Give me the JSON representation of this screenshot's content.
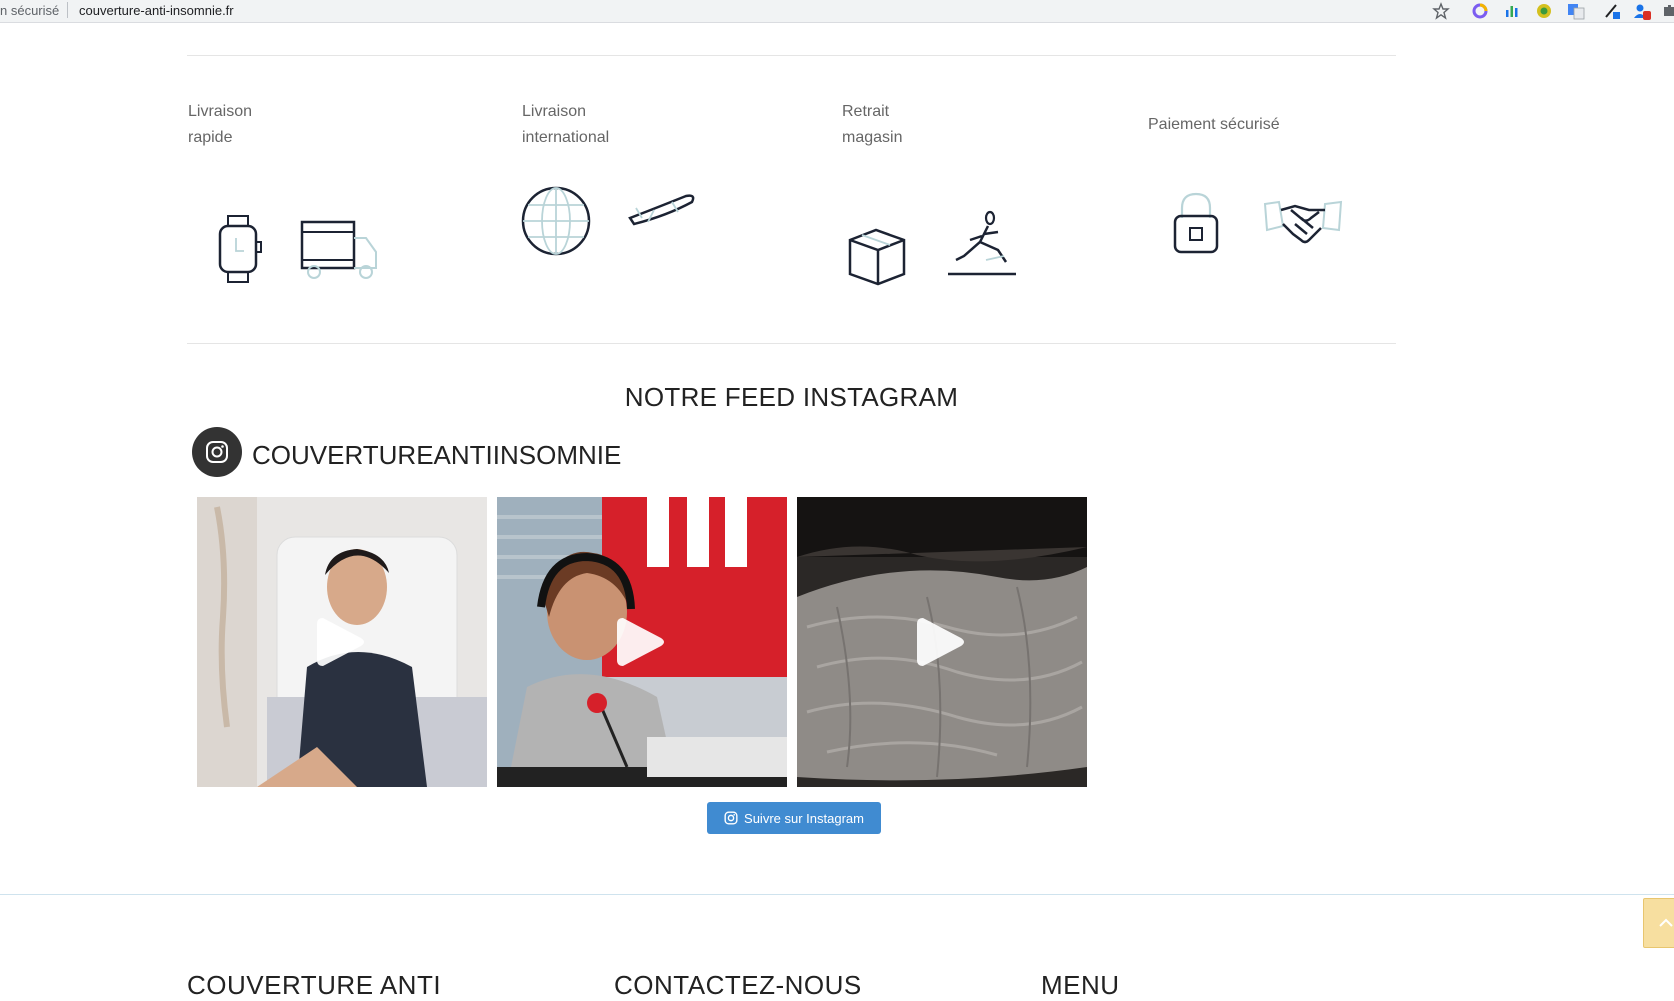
{
  "browser": {
    "security_label": "n sécurisé",
    "url": "couverture-anti-insomnie.fr"
  },
  "features": [
    {
      "label": "Livraison\nrapide"
    },
    {
      "label": "Livraison\ninternational"
    },
    {
      "label": "Retrait\nmagasin"
    },
    {
      "label": "Paiement sécurisé"
    }
  ],
  "instagram": {
    "section_title": "NOTRE FEED INSTAGRAM",
    "handle": "COUVERTUREANTIINSOMNIE",
    "follow_label": "Suivre sur Instagram",
    "posts": [
      {
        "media": "video"
      },
      {
        "media": "video"
      },
      {
        "media": "video"
      }
    ]
  },
  "footer": {
    "headings": [
      "COUVERTURE ANTI",
      "CONTACTEZ-NOUS",
      "MENU"
    ]
  },
  "colors": {
    "follow_button": "#408bd1",
    "icon_stroke": "#1c2333",
    "icon_light": "#b9d4d8"
  }
}
